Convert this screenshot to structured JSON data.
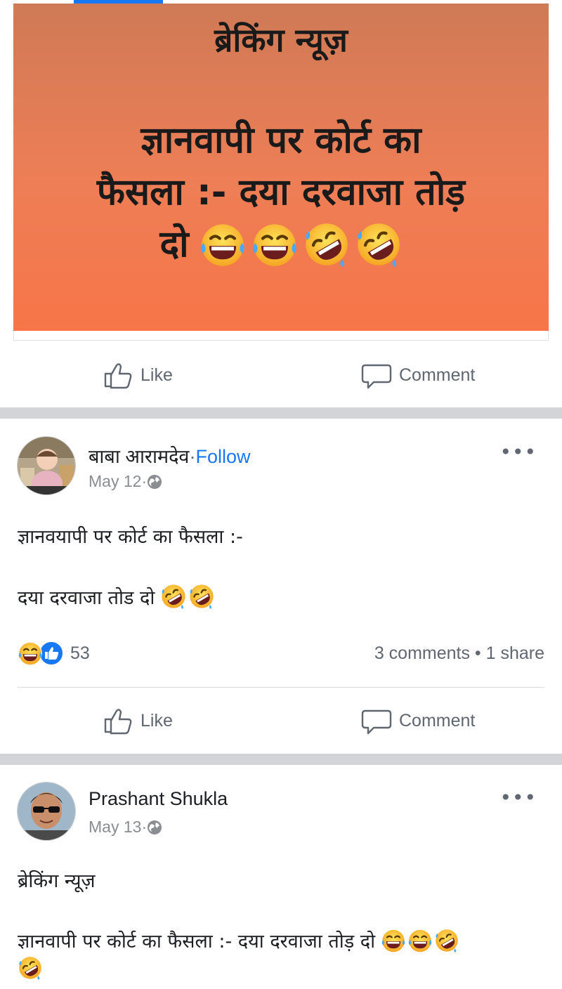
{
  "banner": {
    "title": "ब्रेकिंग न्यूज़",
    "line1": "ज्ञानवापी पर कोर्ट का",
    "line2": "फैसला :- दया दरवाजा तोड़",
    "line3": "दो",
    "background_color": "#ef7a52"
  },
  "actions": {
    "like_label": "Like",
    "comment_label": "Comment"
  },
  "posts": [
    {
      "author": "बाबा आरामदेव",
      "separator": "·",
      "follow_label": "Follow",
      "date": "May 12",
      "date_separator": "·",
      "text_line1": "ज्ञानवयापी पर कोर्ट का फैसला :-",
      "text_line2": "दया दरवाजा तोड दो",
      "reaction_count": "53",
      "stats": "3 comments • 1 share"
    },
    {
      "author": "Prashant Shukla",
      "date": "May 13",
      "date_separator": "·",
      "text_line1": "ब्रेकिंग न्यूज़",
      "text_line2": "ज्ञानवापी पर कोर्ट का फैसला :- दया दरवाजा तोड़ दो"
    }
  ],
  "icons": {
    "more": "more-options-icon",
    "globe": "globe-icon",
    "like": "like-icon",
    "comment": "comment-icon",
    "laugh": "laughing-emoji",
    "rofl": "rofl-emoji"
  },
  "colors": {
    "accent": "#1877f2",
    "secondary_text": "#606770",
    "divider": "#d2d4d8"
  }
}
